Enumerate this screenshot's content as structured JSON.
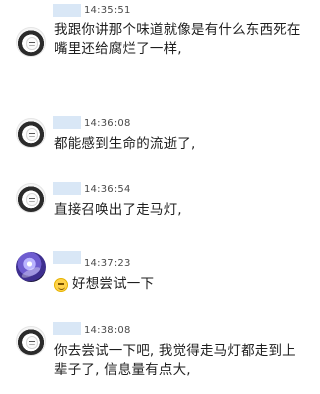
{
  "messages": [
    {
      "time": "14:35:51",
      "lines": [
        "我跟你讲那个味道就像是有什么东西死在",
        "嘴里还给腐烂了一样,"
      ],
      "avatar": "girl-avatar"
    },
    {
      "time": "14:36:08",
      "lines": [
        "都能感到生命的流逝了,"
      ],
      "avatar": "girl-avatar"
    },
    {
      "time": "14:36:54",
      "lines": [
        "直接召唤出了走马灯,"
      ],
      "avatar": "girl-avatar"
    },
    {
      "time": "14:37:23",
      "lines": [
        "好想尝试一下"
      ],
      "avatar": "space-avatar",
      "emoji": "laughing-face-icon"
    },
    {
      "time": "14:38:08",
      "lines": [
        "你去尝试一下吧, 我觉得走马灯都走到上",
        "辈子了, 信息量有点大,"
      ],
      "avatar": "girl-avatar"
    }
  ],
  "colors": {
    "background": "#ffffff",
    "name_redaction": "#d9e7f6",
    "time_text": "#4a4a4a",
    "message_text": "#1e1e1e"
  }
}
